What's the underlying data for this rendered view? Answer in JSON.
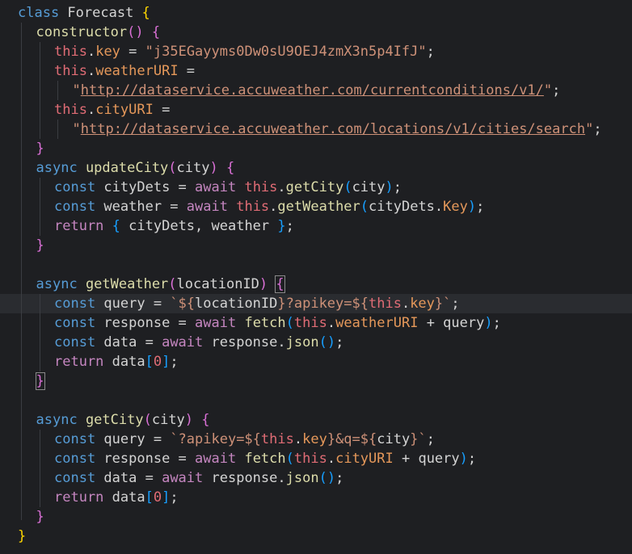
{
  "editor": {
    "lines": [
      {
        "indent": 0,
        "tokens": [
          [
            "kw",
            "class"
          ],
          [
            "pl",
            " Forecast "
          ],
          [
            "b1",
            "{"
          ]
        ]
      },
      {
        "indent": 1,
        "tokens": [
          [
            "fn",
            "constructor"
          ],
          [
            "b2",
            "()"
          ],
          [
            "pl",
            " "
          ],
          [
            "b2",
            "{"
          ]
        ]
      },
      {
        "indent": 2,
        "tokens": [
          [
            "ths",
            "this"
          ],
          [
            "pl",
            "."
          ],
          [
            "prop",
            "key"
          ],
          [
            "pl",
            " = "
          ],
          [
            "str",
            "\"j35EGayyms0Dw0sU9OEJ4zmX3n5p4IfJ\""
          ],
          [
            "pl",
            ";"
          ]
        ]
      },
      {
        "indent": 2,
        "tokens": [
          [
            "ths",
            "this"
          ],
          [
            "pl",
            "."
          ],
          [
            "prop",
            "weatherURI"
          ],
          [
            "pl",
            " ="
          ]
        ]
      },
      {
        "indent": 3,
        "tokens": [
          [
            "str",
            "\""
          ],
          [
            "url",
            "http://dataservice.accuweather.com/currentconditions/v1/"
          ],
          [
            "str",
            "\""
          ],
          [
            "pl",
            ";"
          ]
        ]
      },
      {
        "indent": 2,
        "tokens": [
          [
            "ths",
            "this"
          ],
          [
            "pl",
            "."
          ],
          [
            "prop",
            "cityURI"
          ],
          [
            "pl",
            " ="
          ]
        ]
      },
      {
        "indent": 3,
        "tokens": [
          [
            "str",
            "\""
          ],
          [
            "url",
            "http://dataservice.accuweather.com/locations/v1/cities/search"
          ],
          [
            "str",
            "\""
          ],
          [
            "pl",
            ";"
          ]
        ]
      },
      {
        "indent": 1,
        "tokens": [
          [
            "b2",
            "}"
          ]
        ]
      },
      {
        "indent": 1,
        "tokens": [
          [
            "kw",
            "async"
          ],
          [
            "pl",
            " "
          ],
          [
            "fn",
            "updateCity"
          ],
          [
            "b2",
            "("
          ],
          [
            "pl",
            "city"
          ],
          [
            "b2",
            ")"
          ],
          [
            "pl",
            " "
          ],
          [
            "b2",
            "{"
          ]
        ]
      },
      {
        "indent": 2,
        "tokens": [
          [
            "kw",
            "const"
          ],
          [
            "pl",
            " cityDets = "
          ],
          [
            "ctl",
            "await"
          ],
          [
            "pl",
            " "
          ],
          [
            "ths",
            "this"
          ],
          [
            "pl",
            "."
          ],
          [
            "fn",
            "getCity"
          ],
          [
            "b3",
            "("
          ],
          [
            "pl",
            "city"
          ],
          [
            "b3",
            ")"
          ],
          [
            "pl",
            ";"
          ]
        ]
      },
      {
        "indent": 2,
        "tokens": [
          [
            "kw",
            "const"
          ],
          [
            "pl",
            " weather = "
          ],
          [
            "ctl",
            "await"
          ],
          [
            "pl",
            " "
          ],
          [
            "ths",
            "this"
          ],
          [
            "pl",
            "."
          ],
          [
            "fn",
            "getWeather"
          ],
          [
            "b3",
            "("
          ],
          [
            "pl",
            "cityDets."
          ],
          [
            "prop",
            "Key"
          ],
          [
            "b3",
            ")"
          ],
          [
            "pl",
            ";"
          ]
        ]
      },
      {
        "indent": 2,
        "tokens": [
          [
            "ctl",
            "return"
          ],
          [
            "pl",
            " "
          ],
          [
            "b3",
            "{"
          ],
          [
            "pl",
            " cityDets, weather "
          ],
          [
            "b3",
            "}"
          ],
          [
            "pl",
            ";"
          ]
        ]
      },
      {
        "indent": 1,
        "tokens": [
          [
            "b2",
            "}"
          ]
        ]
      },
      {
        "indent": 0,
        "tokens": []
      },
      {
        "indent": 1,
        "tokens": [
          [
            "kw",
            "async"
          ],
          [
            "pl",
            " "
          ],
          [
            "fn",
            "getWeather"
          ],
          [
            "b2",
            "("
          ],
          [
            "pl",
            "locationID"
          ],
          [
            "b2",
            ")"
          ],
          [
            "pl",
            " "
          ],
          [
            "b2 bm",
            "{"
          ]
        ]
      },
      {
        "indent": 2,
        "active": true,
        "tokens": [
          [
            "kw",
            "const"
          ],
          [
            "pl",
            " query = "
          ],
          [
            "str",
            "`${"
          ],
          [
            "pl",
            "locationID"
          ],
          [
            "str",
            "}?apikey=${"
          ],
          [
            "ths",
            "this"
          ],
          [
            "pl",
            "."
          ],
          [
            "prop",
            "key"
          ],
          [
            "str",
            "}`"
          ],
          [
            "pl",
            ";"
          ]
        ]
      },
      {
        "indent": 2,
        "tokens": [
          [
            "kw",
            "const"
          ],
          [
            "pl",
            " response = "
          ],
          [
            "ctl",
            "await"
          ],
          [
            "pl",
            " "
          ],
          [
            "fn",
            "fetch"
          ],
          [
            "b3",
            "("
          ],
          [
            "ths",
            "this"
          ],
          [
            "pl",
            "."
          ],
          [
            "prop",
            "weatherURI"
          ],
          [
            "pl",
            " + query"
          ],
          [
            "b3",
            ")"
          ],
          [
            "pl",
            ";"
          ]
        ]
      },
      {
        "indent": 2,
        "tokens": [
          [
            "kw",
            "const"
          ],
          [
            "pl",
            " data = "
          ],
          [
            "ctl",
            "await"
          ],
          [
            "pl",
            " response."
          ],
          [
            "fn",
            "json"
          ],
          [
            "b3",
            "()"
          ],
          [
            "pl",
            ";"
          ]
        ]
      },
      {
        "indent": 2,
        "tokens": [
          [
            "ctl",
            "return"
          ],
          [
            "pl",
            " data"
          ],
          [
            "b3",
            "["
          ],
          [
            "num",
            "0"
          ],
          [
            "b3",
            "]"
          ],
          [
            "pl",
            ";"
          ]
        ]
      },
      {
        "indent": 1,
        "tokens": [
          [
            "b2 bm",
            "}"
          ]
        ]
      },
      {
        "indent": 0,
        "tokens": []
      },
      {
        "indent": 1,
        "tokens": [
          [
            "kw",
            "async"
          ],
          [
            "pl",
            " "
          ],
          [
            "fn",
            "getCity"
          ],
          [
            "b2",
            "("
          ],
          [
            "pl",
            "city"
          ],
          [
            "b2",
            ")"
          ],
          [
            "pl",
            " "
          ],
          [
            "b2",
            "{"
          ]
        ]
      },
      {
        "indent": 2,
        "tokens": [
          [
            "kw",
            "const"
          ],
          [
            "pl",
            " query = "
          ],
          [
            "str",
            "`?apikey=${"
          ],
          [
            "ths",
            "this"
          ],
          [
            "pl",
            "."
          ],
          [
            "prop",
            "key"
          ],
          [
            "str",
            "}&q=${"
          ],
          [
            "pl",
            "city"
          ],
          [
            "str",
            "}`"
          ],
          [
            "pl",
            ";"
          ]
        ]
      },
      {
        "indent": 2,
        "tokens": [
          [
            "kw",
            "const"
          ],
          [
            "pl",
            " response = "
          ],
          [
            "ctl",
            "await"
          ],
          [
            "pl",
            " "
          ],
          [
            "fn",
            "fetch"
          ],
          [
            "b3",
            "("
          ],
          [
            "ths",
            "this"
          ],
          [
            "pl",
            "."
          ],
          [
            "prop",
            "cityURI"
          ],
          [
            "pl",
            " + query"
          ],
          [
            "b3",
            ")"
          ],
          [
            "pl",
            ";"
          ]
        ]
      },
      {
        "indent": 2,
        "tokens": [
          [
            "kw",
            "const"
          ],
          [
            "pl",
            " data = "
          ],
          [
            "ctl",
            "await"
          ],
          [
            "pl",
            " response."
          ],
          [
            "fn",
            "json"
          ],
          [
            "b3",
            "()"
          ],
          [
            "pl",
            ";"
          ]
        ]
      },
      {
        "indent": 2,
        "tokens": [
          [
            "ctl",
            "return"
          ],
          [
            "pl",
            " data"
          ],
          [
            "b3",
            "["
          ],
          [
            "num",
            "0"
          ],
          [
            "b3",
            "]"
          ],
          [
            "pl",
            ";"
          ]
        ]
      },
      {
        "indent": 1,
        "tokens": [
          [
            "b2",
            "}"
          ]
        ]
      },
      {
        "indent": 0,
        "tokens": [
          [
            "b1",
            "}"
          ]
        ]
      }
    ]
  }
}
